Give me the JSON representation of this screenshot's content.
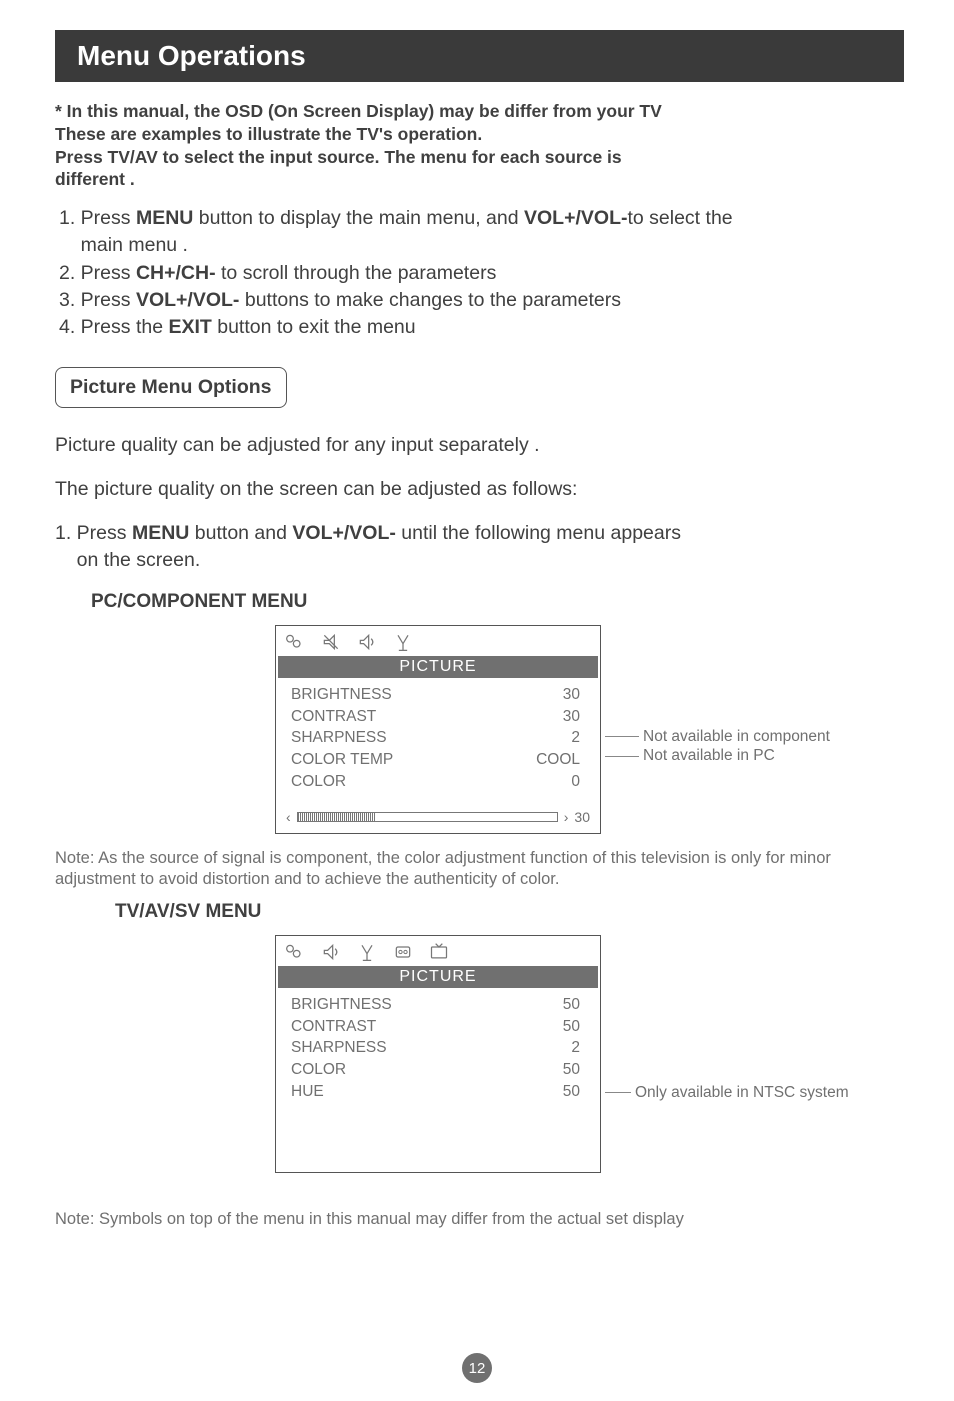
{
  "title": "Menu Operations",
  "intro_l1": "* In this manual, the OSD (On Screen Display) may be differ from your TV",
  "intro_l2": "These are examples to illustrate the TV's operation.",
  "intro_l3": "Press TV/AV to select the input source. The menu for each source is",
  "intro_l4": "different .",
  "step1a": "1. Press ",
  "step1b": "MENU",
  "step1c": " button to  display the main menu, and ",
  "step1d": "VOL+/VOL-",
  "step1e": "to select the",
  "step1f": "    main menu .",
  "step2a": "2. Press ",
  "step2b": "CH+/CH-",
  "step2c": " to scroll through the parameters",
  "step3a": "3. Press ",
  "step3b": "VOL+/VOL-",
  "step3c": " buttons to make changes to the parameters",
  "step4a": "4. Press the ",
  "step4b": "EXIT",
  "step4c": " button to exit the menu",
  "section_label": "Picture Menu Options",
  "para1": "Picture quality can be adjusted for any input separately .",
  "para2": "The picture quality on the screen can be adjusted as follows:",
  "para3a": "1. Press ",
  "para3b": "MENU",
  "para3c": " button and ",
  "para3d": "VOL+/VOL-",
  "para3e": " until the following menu appears",
  "para3f": "    on the screen.",
  "sub1": "PC/COMPONENT MENU",
  "menu1": {
    "tab": "PICTURE",
    "rows": [
      {
        "label": "BRIGHTNESS",
        "value": "30"
      },
      {
        "label": "CONTRAST",
        "value": "30"
      },
      {
        "label": "SHARPNESS",
        "value": "2"
      },
      {
        "label": "COLOR TEMP",
        "value": "COOL"
      },
      {
        "label": "COLOR",
        "value": "0"
      }
    ],
    "slider_value": "30",
    "callout1": "Not available in component",
    "callout2": "Not available in PC"
  },
  "note1": "Note: As the source of signal is component, the color adjustment function of this television is only for minor adjustment to avoid distortion and to achieve the authenticity of color.",
  "sub2": "TV/AV/SV MENU",
  "menu2": {
    "tab": "PICTURE",
    "rows": [
      {
        "label": "BRIGHTNESS",
        "value": "50"
      },
      {
        "label": "CONTRAST",
        "value": "50"
      },
      {
        "label": "SHARPNESS",
        "value": "2"
      },
      {
        "label": "COLOR",
        "value": "50"
      },
      {
        "label": "HUE",
        "value": "50"
      }
    ],
    "callout": "Only available in NTSC system"
  },
  "note2": "Note: Symbols on top of the menu in this manual may differ from the actual set display",
  "page_number": "12",
  "arrow_left": "‹",
  "arrow_right": "›"
}
